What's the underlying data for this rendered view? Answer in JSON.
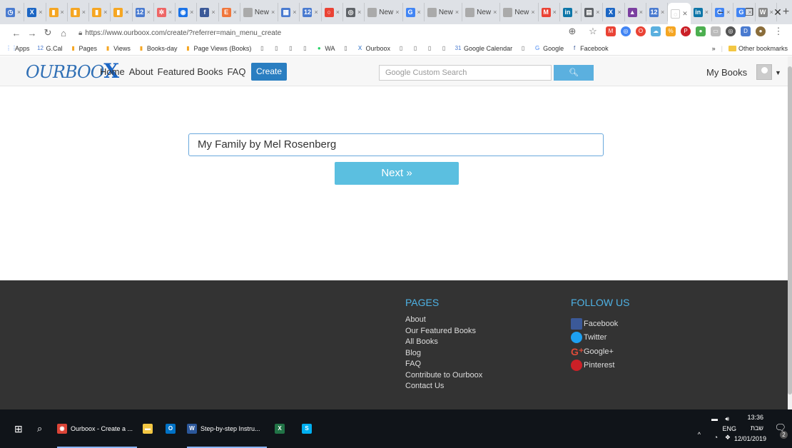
{
  "browser": {
    "tabs": [
      {
        "label": "",
        "color": "#4a7bd0",
        "glyph": "◷"
      },
      {
        "label": "",
        "color": "#1c66c4",
        "glyph": "X"
      },
      {
        "label": "",
        "color": "#f5a623",
        "glyph": "▮"
      },
      {
        "label": "",
        "color": "#f5a623",
        "glyph": "▮"
      },
      {
        "label": "",
        "color": "#f5a623",
        "glyph": "▮"
      },
      {
        "label": "",
        "color": "#f5a623",
        "glyph": "▮"
      },
      {
        "label": "",
        "color": "#4a7bd0",
        "glyph": "12"
      },
      {
        "label": "",
        "color": "#e66",
        "glyph": "✲"
      },
      {
        "label": "",
        "color": "#1a73e8",
        "glyph": "◉"
      },
      {
        "label": "",
        "color": "#3b5998",
        "glyph": "f"
      },
      {
        "label": "",
        "color": "#f0763b",
        "glyph": "E"
      },
      {
        "label": "New",
        "color": "#aaa",
        "glyph": ""
      },
      {
        "label": "",
        "color": "#4a7bd0",
        "glyph": "▦"
      },
      {
        "label": "",
        "color": "#4a7bd0",
        "glyph": "12"
      },
      {
        "label": "",
        "color": "#ea4335",
        "glyph": "○"
      },
      {
        "label": "",
        "color": "#5f6368",
        "glyph": "◎"
      },
      {
        "label": "New",
        "color": "#aaa",
        "glyph": ""
      },
      {
        "label": "",
        "color": "#4285f4",
        "glyph": "G"
      },
      {
        "label": "New",
        "color": "#aaa",
        "glyph": ""
      },
      {
        "label": "New",
        "color": "#aaa",
        "glyph": ""
      },
      {
        "label": "New",
        "color": "#aaa",
        "glyph": ""
      },
      {
        "label": "",
        "color": "#ea4335",
        "glyph": "M"
      },
      {
        "label": "",
        "color": "#0e76a8",
        "glyph": "in"
      },
      {
        "label": "",
        "color": "#5f6368",
        "glyph": "▤"
      },
      {
        "label": "",
        "color": "#1c66c4",
        "glyph": "X"
      },
      {
        "label": "",
        "color": "#7b3fa0",
        "glyph": "▲"
      },
      {
        "label": "",
        "color": "#4a7bd0",
        "glyph": "12"
      }
    ],
    "tabs_after_active": [
      {
        "label": "",
        "color": "#0e76a8",
        "glyph": "in"
      },
      {
        "label": "",
        "color": "#4285f4",
        "glyph": "G"
      },
      {
        "label": "",
        "color": "#4285f4",
        "glyph": "G"
      },
      {
        "label": "",
        "color": "#888",
        "glyph": "W"
      }
    ],
    "new_tab": "+",
    "window_controls": {
      "minimize": "−",
      "maximize": "❐",
      "close": "✕"
    },
    "url": "https://www.ourboox.com/create/?referrer=main_menu_create",
    "bookmarks": [
      {
        "label": "Apps",
        "icon": "apps-icon",
        "glyph": "⋮⋮",
        "color": "#4285f4"
      },
      {
        "label": "G.Cal",
        "icon": "calendar-icon",
        "glyph": "12",
        "color": "#4a7bd0"
      },
      {
        "label": "Pages",
        "icon": "bar-chart-icon",
        "glyph": "▮",
        "color": "#f5a623"
      },
      {
        "label": "Views",
        "icon": "bar-chart-icon",
        "glyph": "▮",
        "color": "#f5a623"
      },
      {
        "label": "Books-day",
        "icon": "bar-chart-icon",
        "glyph": "▮",
        "color": "#f5a623"
      },
      {
        "label": "Page Views (Books)",
        "icon": "bar-chart-icon",
        "glyph": "▮",
        "color": "#f5a623"
      },
      {
        "label": "",
        "icon": "page-icon",
        "glyph": "▯",
        "color": "#666"
      },
      {
        "label": "",
        "icon": "page-icon",
        "glyph": "▯",
        "color": "#666"
      },
      {
        "label": "",
        "icon": "page-icon",
        "glyph": "▯",
        "color": "#666"
      },
      {
        "label": "",
        "icon": "page-icon",
        "glyph": "▯",
        "color": "#666"
      },
      {
        "label": "WA",
        "icon": "whatsapp-icon",
        "glyph": "●",
        "color": "#25d366"
      },
      {
        "label": "",
        "icon": "page-icon",
        "glyph": "▯",
        "color": "#666"
      },
      {
        "label": "Ourboox",
        "icon": "ourboox-icon",
        "glyph": "X",
        "color": "#1c66c4"
      },
      {
        "label": "",
        "icon": "page-icon",
        "glyph": "▯",
        "color": "#666"
      },
      {
        "label": "",
        "icon": "page-icon",
        "glyph": "▯",
        "color": "#666"
      },
      {
        "label": "",
        "icon": "page-icon",
        "glyph": "▯",
        "color": "#666"
      },
      {
        "label": "",
        "icon": "page-icon",
        "glyph": "▯",
        "color": "#666"
      },
      {
        "label": "Google Calendar",
        "icon": "calendar-icon",
        "glyph": "31",
        "color": "#4a7bd0"
      },
      {
        "label": "",
        "icon": "page-icon",
        "glyph": "▯",
        "color": "#666"
      },
      {
        "label": "Google",
        "icon": "google-icon",
        "glyph": "G",
        "color": "#4285f4"
      },
      {
        "label": "Facebook",
        "icon": "facebook-icon",
        "glyph": "f",
        "color": "#3b5998"
      }
    ],
    "bookmarks_overflow": "»",
    "other_bookmarks": "Other bookmarks"
  },
  "site": {
    "logo": "OURBOO",
    "logo_x": "X",
    "nav": [
      "Home",
      "About",
      "Featured Books",
      "FAQ"
    ],
    "create": "Create",
    "search_placeholder": "Google Custom Search",
    "my_books": "My Books"
  },
  "main": {
    "book_title": "My Family by Mel Rosenberg",
    "next": "Next »"
  },
  "footer": {
    "pages_title": "PAGES",
    "pages": [
      "About",
      "Our Featured Books",
      "All Books",
      "Blog",
      "FAQ",
      "Contribute to Ourboox",
      "Contact Us"
    ],
    "follow_title": "FOLLOW US",
    "social": [
      {
        "label": "Facebook",
        "color": "#3b5998",
        "icon": "facebook-icon"
      },
      {
        "label": "Twitter",
        "color": "#1da1f2",
        "icon": "twitter-icon"
      },
      {
        "label": "Google+",
        "color": "#dd4b39",
        "icon": "google-plus-icon"
      },
      {
        "label": "Pinterest",
        "color": "#cb2027",
        "icon": "pinterest-icon"
      }
    ]
  },
  "taskbar": {
    "items": [
      {
        "label": "Ourboox - Create a ...",
        "icon": "chrome-icon",
        "glyph": "◉",
        "color": "#db4437",
        "active": true
      },
      {
        "label": "",
        "icon": "file-explorer-icon",
        "glyph": "▬",
        "color": "#f3c743",
        "active": false
      },
      {
        "label": "",
        "icon": "outlook-icon",
        "glyph": "O",
        "color": "#0072c6",
        "active": false
      },
      {
        "label": "Step-by-step Instru...",
        "icon": "word-icon",
        "glyph": "W",
        "color": "#2b579a",
        "active": true
      },
      {
        "label": "",
        "icon": "excel-icon",
        "glyph": "X",
        "color": "#217346",
        "active": false
      },
      {
        "label": "",
        "icon": "skype-icon",
        "glyph": "S",
        "color": "#00aff0",
        "active": false
      }
    ],
    "lang": "ENG",
    "time": "13:36",
    "day": "שבת",
    "date": "12/01/2019",
    "notifications_count": "2"
  }
}
